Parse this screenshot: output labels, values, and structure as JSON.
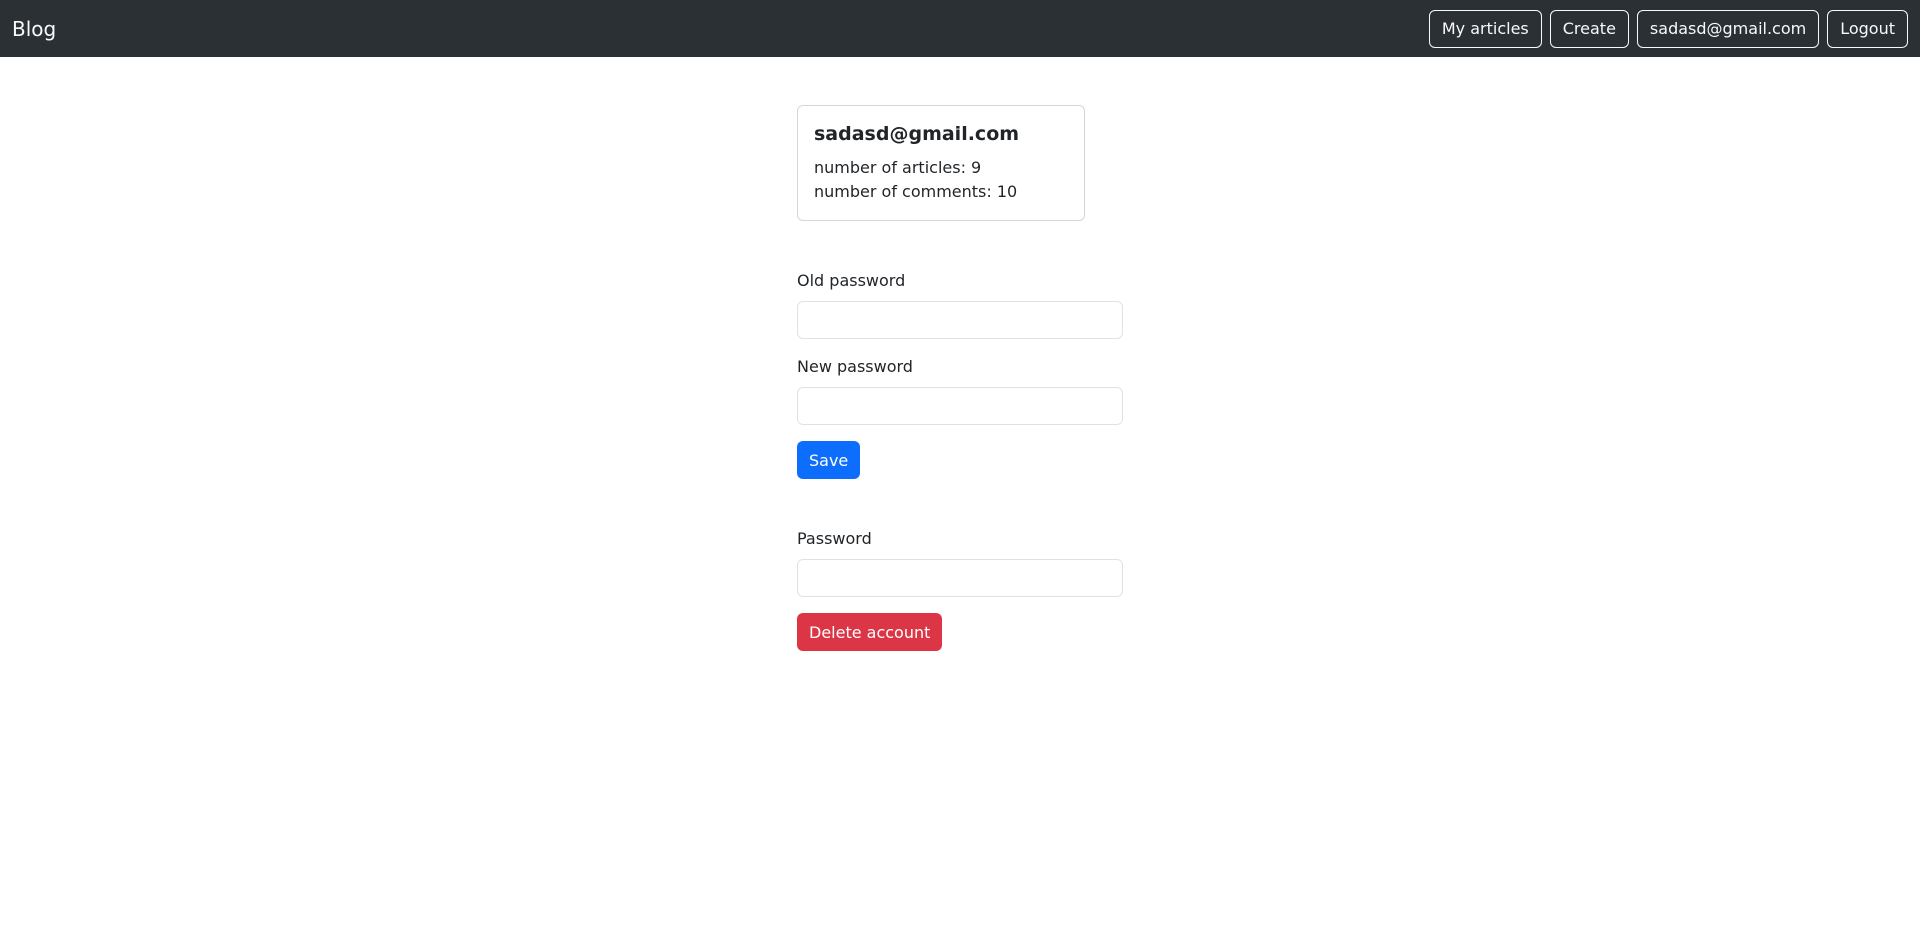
{
  "navbar": {
    "brand": "Blog",
    "items": [
      {
        "label": "My articles"
      },
      {
        "label": "Create"
      },
      {
        "label": "sadasd@gmail.com"
      },
      {
        "label": "Logout"
      }
    ]
  },
  "profile": {
    "email": "sadasd@gmail.com",
    "articles_text": "number of articles: 9",
    "comments_text": "number of comments: 10",
    "articles_count": 9,
    "comments_count": 10
  },
  "change_password_form": {
    "old_password_label": "Old password",
    "old_password_value": "",
    "new_password_label": "New password",
    "new_password_value": "",
    "save_label": "Save"
  },
  "delete_account_form": {
    "password_label": "Password",
    "password_value": "",
    "delete_label": "Delete account"
  },
  "colors": {
    "navbar_bg": "#2b3035",
    "primary": "#0d6efd",
    "danger": "#dc3545"
  }
}
